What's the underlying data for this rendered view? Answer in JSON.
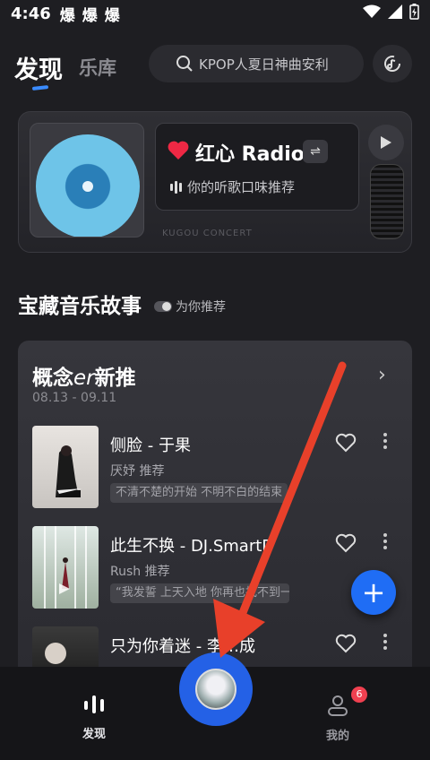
{
  "status_bar": {
    "time": "4:46",
    "notifications": [
      "爆",
      "爆",
      "爆"
    ]
  },
  "header": {
    "tabs": [
      {
        "label": "发现"
      },
      {
        "label": "乐库"
      }
    ],
    "search": {
      "placeholder": "KPOP人夏日神曲安利"
    }
  },
  "radio": {
    "title": "红心 Radio",
    "subtitle": "你的听歌口味推荐",
    "record_label_text": "KUGOU CONCERT"
  },
  "section": {
    "title": "宝藏音乐故事",
    "tag": "为你推荐"
  },
  "story_card": {
    "title_prefix": "概念",
    "title_er": "er",
    "title_suffix": "新推",
    "date": "08.13 - 09.11",
    "songs": [
      {
        "title": "侧脸 - 于果",
        "rec": "厌妤 推荐",
        "quote": "不清不楚的开始 不明不白的结束"
      },
      {
        "title": "此生不换 - DJ.SmartD",
        "rec": "Rush 推荐",
        "quote": "“我发誓 上天入地 你再也找不到一个比我更有"
      },
      {
        "title": "只为你着迷 - 李…成",
        "rec": "",
        "quote": ""
      }
    ]
  },
  "bottom_nav": {
    "discover_label": "发现",
    "me_label": "我的",
    "me_badge": "6"
  },
  "colors": {
    "accent": "#1f6df5",
    "arrow": "#e8402a",
    "badge": "#f04050"
  }
}
